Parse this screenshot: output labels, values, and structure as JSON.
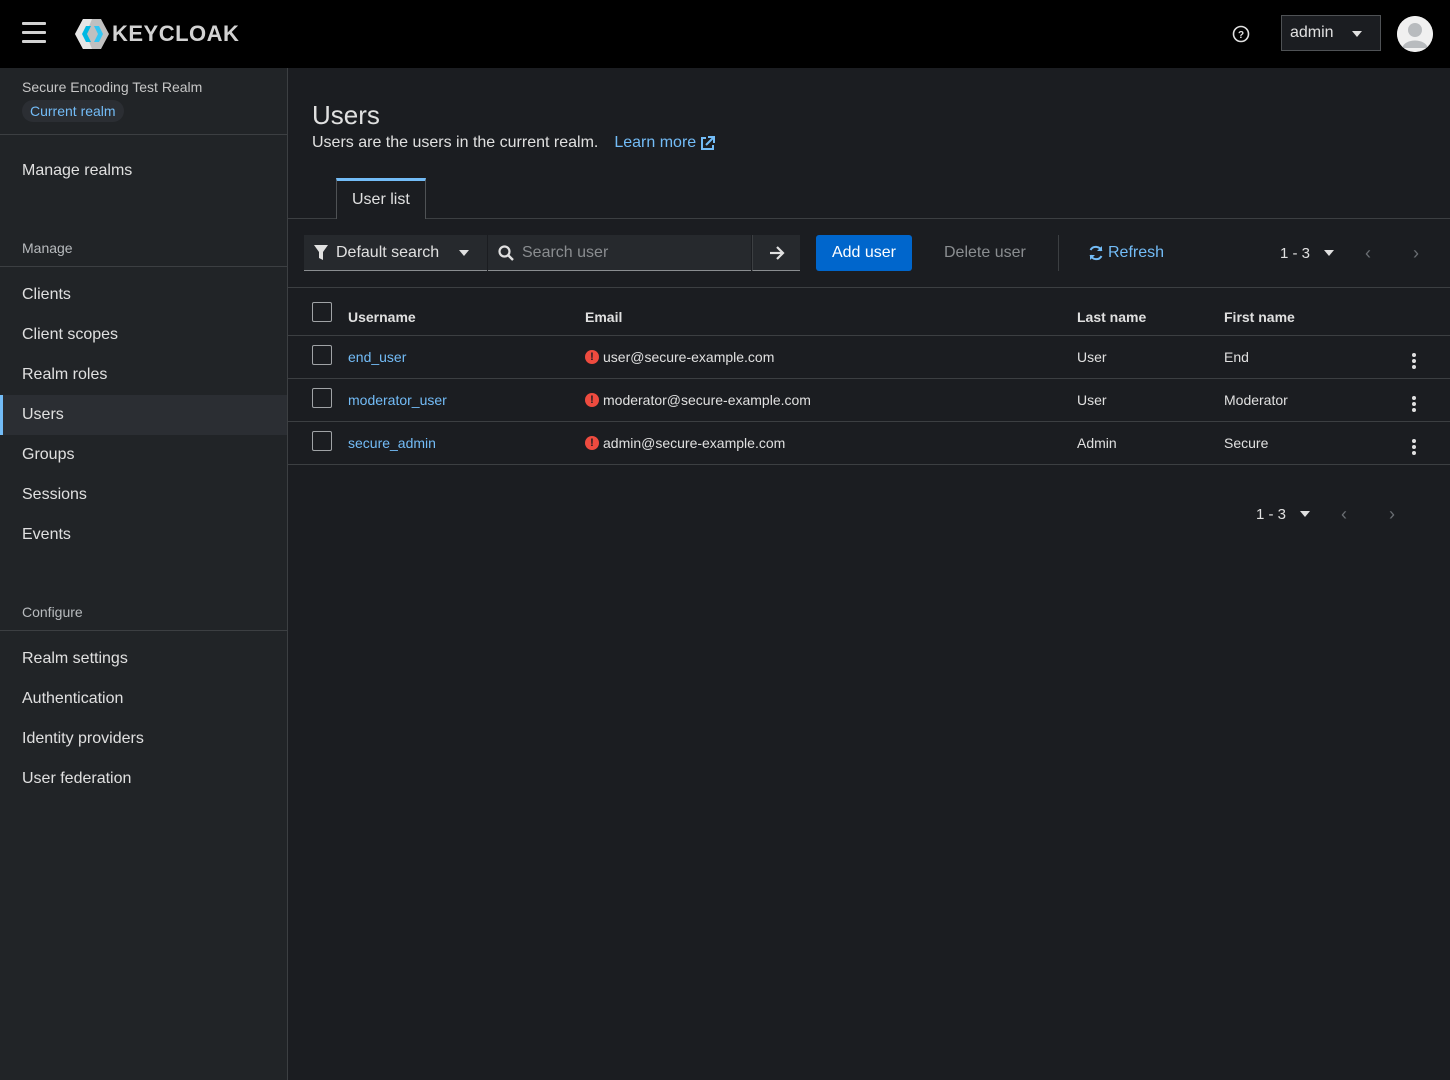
{
  "header": {
    "logo_text": "KEYCLOAK",
    "user_menu_label": "admin",
    "icons": {
      "menu": "hamburger-icon",
      "help": "help-icon",
      "avatar": "avatar-icon"
    }
  },
  "sidebar": {
    "realm_name": "Secure Encoding Test Realm",
    "realm_badge": "Current realm",
    "manage_realms": "Manage realms",
    "manage_section": "Manage",
    "manage_items": [
      "Clients",
      "Client scopes",
      "Realm roles",
      "Users",
      "Groups",
      "Sessions",
      "Events"
    ],
    "active_item": "Users",
    "configure_section": "Configure",
    "configure_items": [
      "Realm settings",
      "Authentication",
      "Identity providers",
      "User federation"
    ]
  },
  "page": {
    "title": "Users",
    "description": "Users are the users in the current realm.",
    "learn_more": "Learn more",
    "tabs": [
      "User list"
    ]
  },
  "toolbar": {
    "filter_label": "Default search",
    "search_placeholder": "Search user",
    "add_user": "Add user",
    "delete_user": "Delete user",
    "refresh": "Refresh",
    "pagination_range": "1 - 3"
  },
  "table": {
    "columns": [
      "Username",
      "Email",
      "Last name",
      "First name"
    ],
    "rows": [
      {
        "username": "end_user",
        "email": "user@secure-example.com",
        "last_name": "User",
        "first_name": "End"
      },
      {
        "username": "moderator_user",
        "email": "moderator@secure-example.com",
        "last_name": "User",
        "first_name": "Moderator"
      },
      {
        "username": "secure_admin",
        "email": "admin@secure-example.com",
        "last_name": "Admin",
        "first_name": "Secure"
      }
    ]
  },
  "footer": {
    "pagination_range": "1 - 3"
  },
  "colors": {
    "accent": "#73bcf7",
    "primary_button": "#0066cc",
    "warning": "#ee4b3f",
    "masthead": "#000000"
  }
}
